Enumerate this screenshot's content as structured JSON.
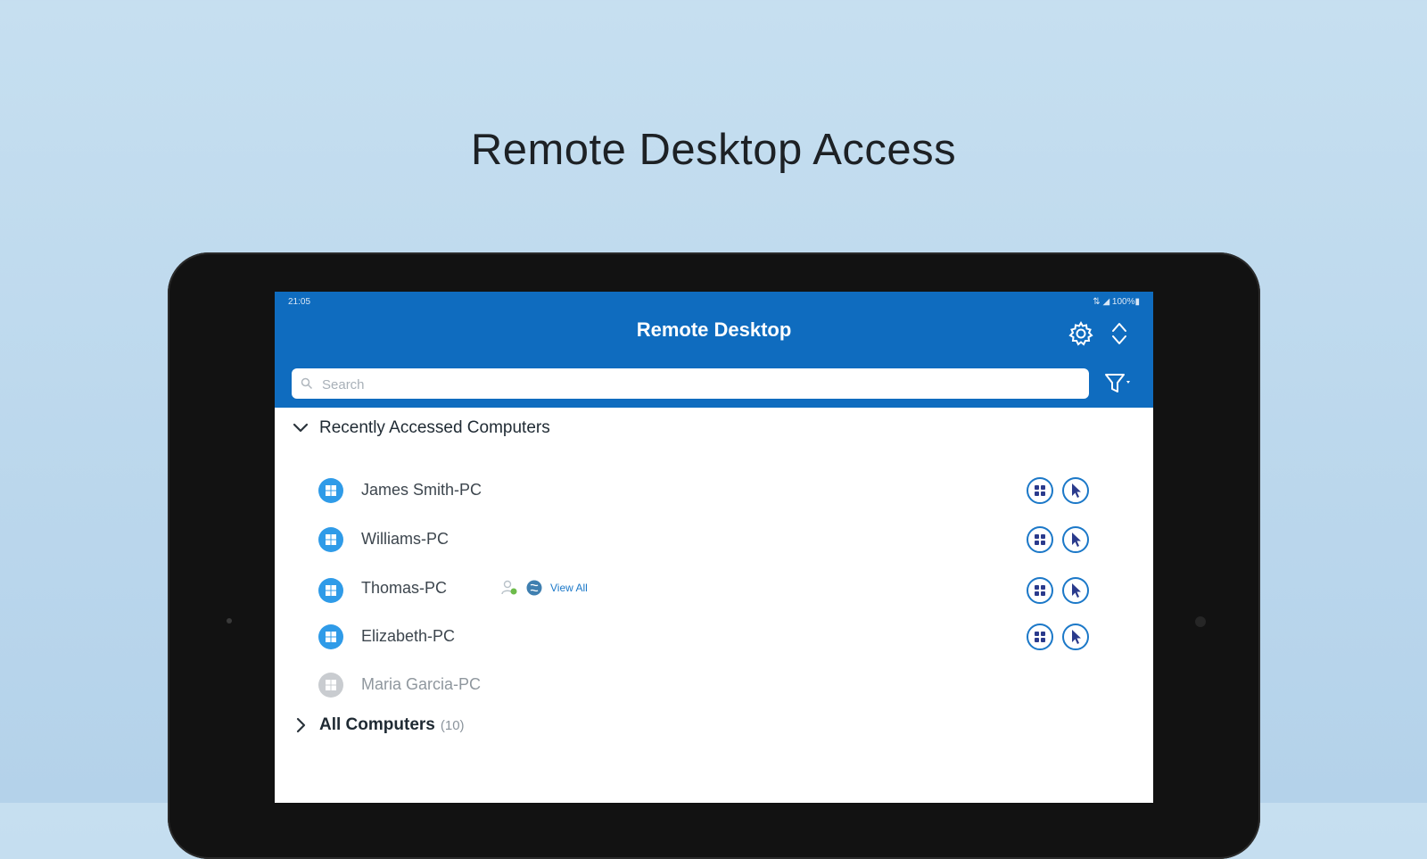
{
  "headline": "Remote Desktop Access",
  "status_bar": {
    "time": "21:05",
    "indicators": "⇅ ◢ 100%▮"
  },
  "app": {
    "title": "Remote Desktop",
    "settings_icon": "gear-icon",
    "sort_icon": "sort-arrows-icon",
    "filter_icon": "filter-icon"
  },
  "search": {
    "placeholder": "Search",
    "value": ""
  },
  "sections": {
    "recent": {
      "title": "Recently Accessed Computers",
      "expanded": true
    },
    "all": {
      "title": "All Computers",
      "count": "(10)",
      "expanded": false
    }
  },
  "computers": [
    {
      "name": "James Smith-PC",
      "online": true
    },
    {
      "name": "Williams-PC",
      "online": true
    },
    {
      "name": "Thomas-PC",
      "online": true,
      "view_all": "View All"
    },
    {
      "name": "Elizabeth-PC",
      "online": true
    },
    {
      "name": "Maria Garcia-PC",
      "online": false
    }
  ],
  "colors": {
    "app_bar": "#0f6cbf",
    "accent": "#1b78c8",
    "os_icon_online": "#2f9be8",
    "os_icon_offline": "#c9ccd0"
  }
}
